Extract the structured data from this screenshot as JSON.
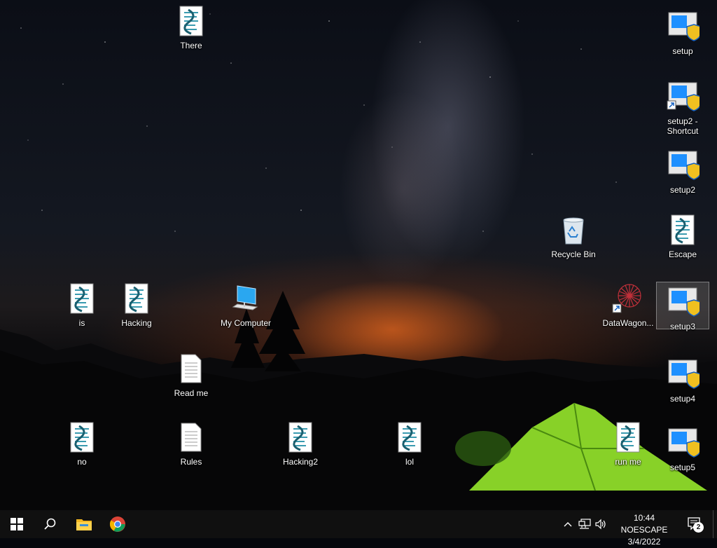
{
  "desktop": {
    "icons": [
      {
        "id": "there",
        "label": "There",
        "type": "script"
      },
      {
        "id": "setup",
        "label": "setup",
        "type": "setup"
      },
      {
        "id": "setup2_shortcut",
        "label": "setup2 - Shortcut",
        "type": "setup-shortcut"
      },
      {
        "id": "setup2",
        "label": "setup2",
        "type": "setup"
      },
      {
        "id": "recycle_bin",
        "label": "Recycle Bin",
        "type": "recycle-bin"
      },
      {
        "id": "escape",
        "label": "Escape",
        "type": "script"
      },
      {
        "id": "is",
        "label": "is",
        "type": "script"
      },
      {
        "id": "hacking",
        "label": "Hacking",
        "type": "script"
      },
      {
        "id": "my_computer",
        "label": "My Computer",
        "type": "computer"
      },
      {
        "id": "datawagon",
        "label": "DataWagon...",
        "type": "shortcut-app"
      },
      {
        "id": "setup3",
        "label": "setup3",
        "type": "setup",
        "selected": true
      },
      {
        "id": "read_me",
        "label": "Read me",
        "type": "text-file"
      },
      {
        "id": "setup4",
        "label": "setup4",
        "type": "setup"
      },
      {
        "id": "no",
        "label": "no",
        "type": "script"
      },
      {
        "id": "rules",
        "label": "Rules",
        "type": "text-file"
      },
      {
        "id": "hacking2",
        "label": "Hacking2",
        "type": "script"
      },
      {
        "id": "lol",
        "label": "lol",
        "type": "script"
      },
      {
        "id": "run_me",
        "label": "run me",
        "type": "script"
      },
      {
        "id": "setup5",
        "label": "setup5",
        "type": "setup"
      }
    ]
  },
  "taskbar": {
    "start_icon": "windows-start-icon",
    "search_icon": "search-icon",
    "pinned": [
      {
        "name": "file-explorer-icon"
      },
      {
        "name": "chrome-icon"
      }
    ],
    "tray": {
      "chevron_icon": "chevron-up-icon",
      "network_icon": "network-icon",
      "volume_icon": "volume-icon",
      "clock_time": "10:44 NOESCAPE",
      "clock_date": "3/4/2022",
      "notification_count": "2"
    }
  },
  "colors": {
    "taskbar_bg": "#101010",
    "setup_blue": "#1e90ff",
    "shield_yellow": "#f0c020",
    "tent_green": "#8fdc2a"
  }
}
